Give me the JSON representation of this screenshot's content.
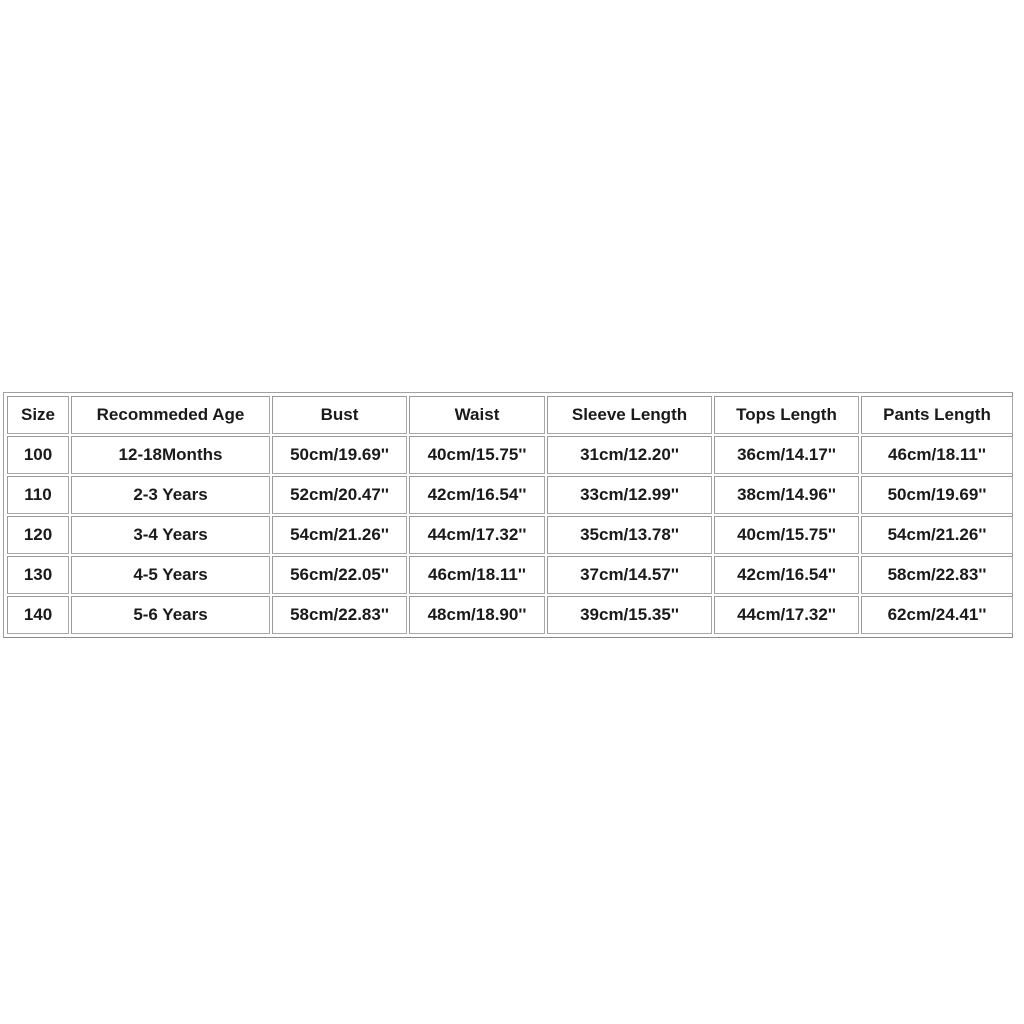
{
  "size_chart": {
    "headers": [
      "Size",
      "Recommeded Age",
      "Bust",
      "Waist",
      "Sleeve Length",
      "Tops Length",
      "Pants Length"
    ],
    "rows": [
      [
        "100",
        "12-18Months",
        "50cm/19.69''",
        "40cm/15.75''",
        "31cm/12.20''",
        "36cm/14.17''",
        "46cm/18.11''"
      ],
      [
        "110",
        "2-3 Years",
        "52cm/20.47''",
        "42cm/16.54''",
        "33cm/12.99''",
        "38cm/14.96''",
        "50cm/19.69''"
      ],
      [
        "120",
        "3-4 Years",
        "54cm/21.26''",
        "44cm/17.32''",
        "35cm/13.78''",
        "40cm/15.75''",
        "54cm/21.26''"
      ],
      [
        "130",
        "4-5 Years",
        "56cm/22.05''",
        "46cm/18.11''",
        "37cm/14.57''",
        "42cm/16.54''",
        "58cm/22.83''"
      ],
      [
        "140",
        "5-6 Years",
        "58cm/22.83''",
        "48cm/18.90''",
        "39cm/15.35''",
        "44cm/17.32''",
        "62cm/24.41''"
      ]
    ]
  }
}
